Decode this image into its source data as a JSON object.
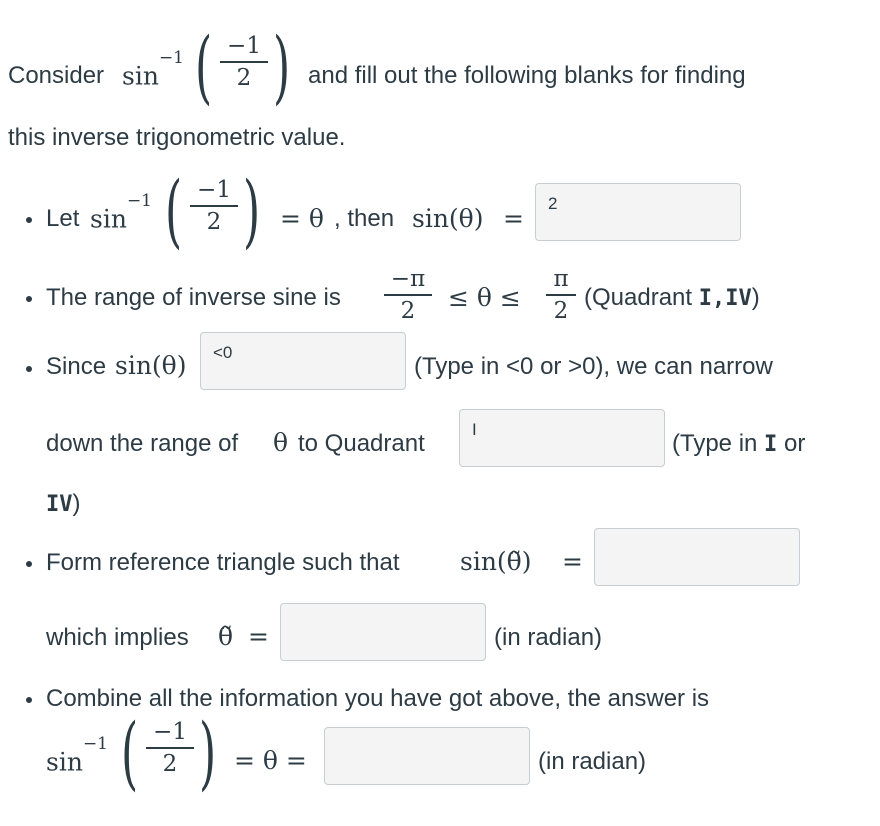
{
  "intro": {
    "prefix": "Consider",
    "func": "sin",
    "exp": "−1",
    "frac_num": "−1",
    "frac_den": "2",
    "suffix": "and fill out the following blanks for finding",
    "line2": "this inverse trigonometric value."
  },
  "step1": {
    "label": "Let",
    "func": "sin",
    "exp": "−1",
    "frac_num": "−1",
    "frac_den": "2",
    "eq_theta": "= θ",
    "then": ", then",
    "sin_theta": "sin(θ)",
    "eq": "=",
    "input_value": "2"
  },
  "step2": {
    "text": "The range of inverse sine is",
    "lo_num": "−π",
    "lo_den": "2",
    "ineq": "≤ θ ≤",
    "hi_num": "π",
    "hi_den": "2",
    "quad_open": "(Quadrant",
    "quad_mono": "I,IV",
    "quad_close": ")"
  },
  "step3": {
    "label": "Since",
    "sin_theta": "sin(θ)",
    "input_value": "<0",
    "hint": "(Type in <0 or >0), we can narrow",
    "line2_prefix": "down the range of",
    "theta": "θ",
    "line2_suffix": "to Quadrant",
    "input2_value": "I",
    "hint2_open": "(Type in",
    "hint2_mono1": "I",
    "hint2_or": "or",
    "hint2_mono2": "IV",
    "hint2_close": ")"
  },
  "step4": {
    "text": "Form reference triangle such that",
    "sin_tilde": "sin(θ̃)",
    "eq": "=",
    "input_value": "",
    "line2_prefix": "which implies",
    "tilde_theta": "θ̃",
    "eq2": "=",
    "input2_value": "",
    "unit": "(in radian)"
  },
  "step5": {
    "text": "Combine all the information you have got above, the answer is",
    "func": "sin",
    "exp": "−1",
    "frac_num": "−1",
    "frac_den": "2",
    "eq_theta_eq": "= θ =",
    "input_value": "",
    "unit": "(in radian)"
  }
}
